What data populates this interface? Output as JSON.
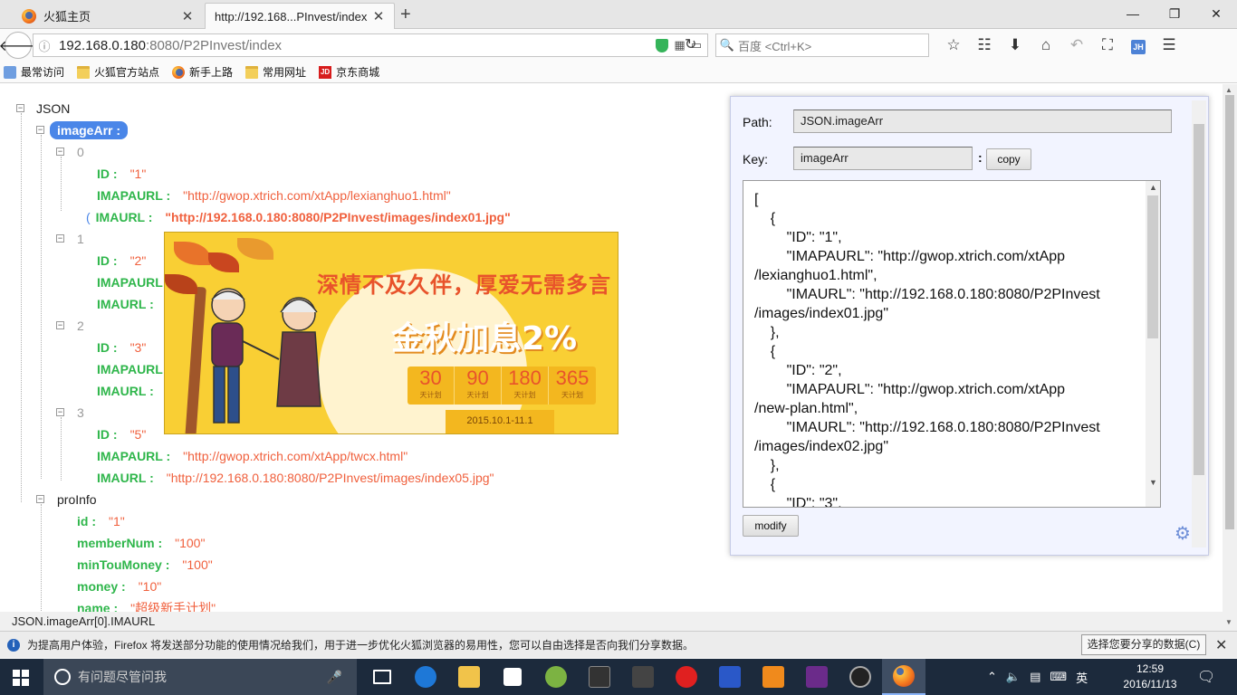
{
  "browser": {
    "tabs": [
      {
        "title": "火狐主页",
        "active": false
      },
      {
        "title": "http://192.168...PInvest/index",
        "active": true
      }
    ],
    "url_host": "192.168.0.180",
    "url_rest": ":8080/P2PInvest/index",
    "search_placeholder": "百度 <Ctrl+K>",
    "account_badge": "JH",
    "bookmarks": [
      {
        "label": "最常访问",
        "icon": "recent-icon"
      },
      {
        "label": "火狐官方站点",
        "icon": "folder-icon"
      },
      {
        "label": "新手上路",
        "icon": "firefox-icon"
      },
      {
        "label": "常用网址",
        "icon": "folder-icon"
      },
      {
        "label": "京东商城",
        "icon": "jd-icon"
      }
    ]
  },
  "tree": {
    "root": "JSON",
    "imageArr_key": "imageArr :",
    "items": [
      {
        "index": "0",
        "id": "\"1\"",
        "imapaurl": "\"http://gwop.xtrich.com/xtApp/lexianghuo1.html\"",
        "imaurl": "\"http://192.168.0.180:8080/P2PInvest/images/index01.jpg\""
      },
      {
        "index": "1",
        "id": "\"2\""
      },
      {
        "index": "2",
        "id": "\"3\""
      },
      {
        "index": "3",
        "id": "\"5\"",
        "imapaurl": "\"http://gwop.xtrich.com/xtApp/twcx.html\"",
        "imaurl": "\"http://192.168.0.180:8080/P2PInvest/images/index05.jpg\""
      }
    ],
    "labels": {
      "id": "ID :",
      "imapaurl": "IMAPAURL :",
      "imaurl": "IMAURL :",
      "imapaurl_short": "IMAPAURL",
      "imaurl_short": "IMAURL :"
    },
    "proInfo": {
      "key": "proInfo",
      "fields": [
        {
          "key": "id :",
          "value": "\"1\""
        },
        {
          "key": "memberNum :",
          "value": "\"100\""
        },
        {
          "key": "minTouMoney :",
          "value": "\"100\""
        },
        {
          "key": "money :",
          "value": "\"10\""
        },
        {
          "key": "name :",
          "value": "\"超级新手计划\""
        }
      ]
    }
  },
  "banner": {
    "slogan": "深情不及久伴，厚爱无需多言",
    "headline": "金秋加息2%",
    "plans": [
      {
        "num": "30",
        "unit": "天计划"
      },
      {
        "num": "90",
        "unit": "天计划"
      },
      {
        "num": "180",
        "unit": "天计划"
      },
      {
        "num": "365",
        "unit": "天计划"
      }
    ],
    "date": "2015.10.1-11.1"
  },
  "panel": {
    "path_label": "Path:",
    "path_value": "JSON.imageArr",
    "key_label": "Key:",
    "key_value": "imageArr",
    "colon": ":",
    "copy_label": "copy",
    "modify_label": "modify",
    "json_text": "[\n    {\n        \"ID\": \"1\",\n        \"IMAPAURL\": \"http://gwop.xtrich.com/xtApp\n/lexianghuo1.html\",\n        \"IMAURL\": \"http://192.168.0.180:8080/P2PInvest\n/images/index01.jpg\"\n    },\n    {\n        \"ID\": \"2\",\n        \"IMAPAURL\": \"http://gwop.xtrich.com/xtApp\n/new-plan.html\",\n        \"IMAURL\": \"http://192.168.0.180:8080/P2PInvest\n/images/index02.jpg\"\n    },\n    {\n        \"ID\": \"3\","
  },
  "status": {
    "path": "JSON.imageArr[0].IMAURL",
    "notification": "为提高用户体验，Firefox 将发送部分功能的使用情况给我们，用于进一步优化火狐浏览器的易用性，您可以自由选择是否向我们分享数据。",
    "notification_button": "选择您要分享的数据(C)"
  },
  "taskbar": {
    "search_placeholder": "有问题尽管问我",
    "ime": "英",
    "time": "12:59",
    "date": "2016/11/13"
  },
  "colors": {
    "key_green": "#2fb64b",
    "value_orange": "#f0603d",
    "selected_blue": "#4a86e8",
    "panel_bg": "#f2f4ff"
  }
}
